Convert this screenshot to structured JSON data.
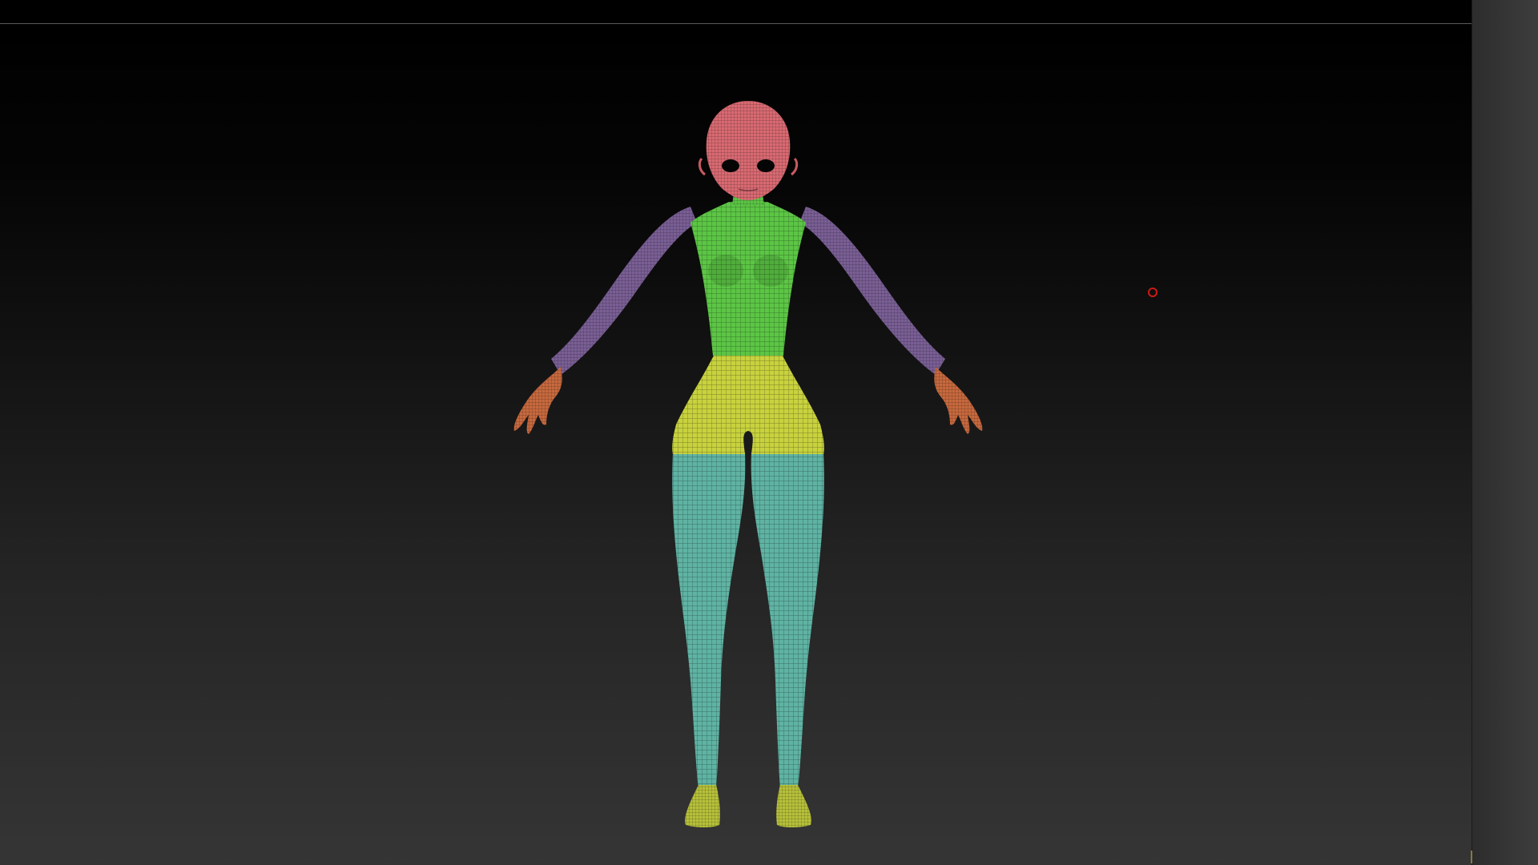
{
  "app": {
    "viewport_background_top": "#000000",
    "viewport_background_bottom": "#353535"
  },
  "model": {
    "icon": "polygroup-mesh-figure",
    "polygroup_colors": {
      "head": "#d96a72",
      "torso": "#5cc545",
      "arms": "#7a5f95",
      "hips": "#c8d23e",
      "legs": "#5fb3a3",
      "hands": "#c7693e",
      "feet": "#b7c13a"
    }
  },
  "cursor": {
    "icon": "brush-cursor-icon",
    "color": "#d01818"
  }
}
